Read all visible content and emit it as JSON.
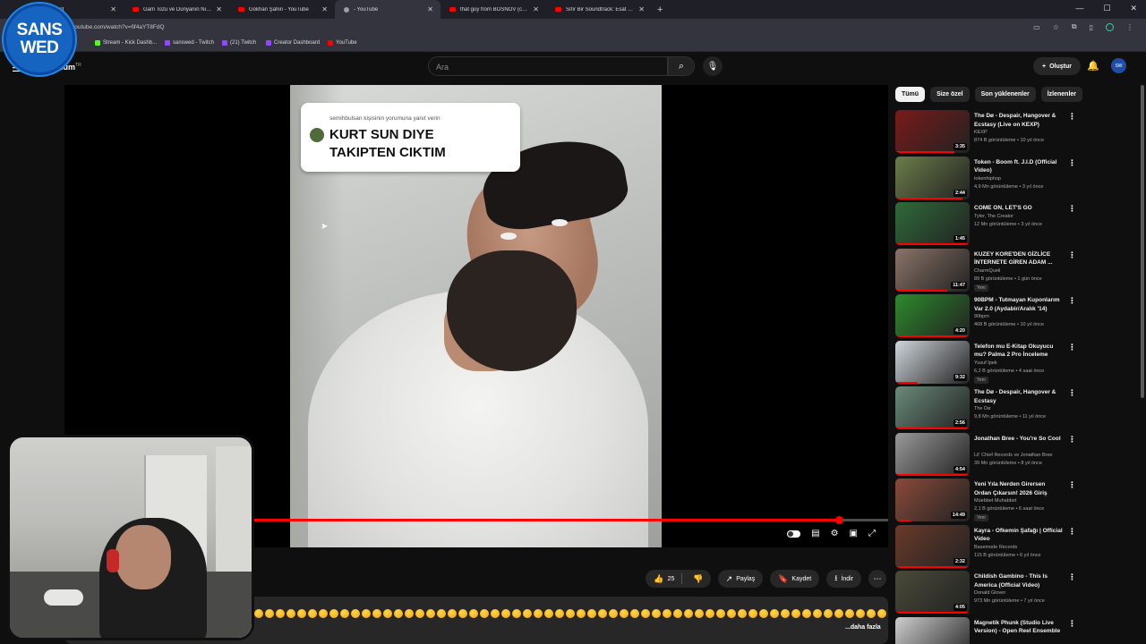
{
  "browser": {
    "tabs": [
      {
        "label": "Dashboard",
        "favicon": "youtube-icon"
      },
      {
        "label": "Gam Tozu ve Dünyanın Ninnisi",
        "favicon": "youtube-icon"
      },
      {
        "label": "Gökhan Şahin - YouTube",
        "favicon": "youtube-icon"
      },
      {
        "label": "- YouTube",
        "favicon": "youtube-icon"
      },
      {
        "label": "that guy from BOSNOV (compilation",
        "favicon": "youtube-icon"
      },
      {
        "label": "Sıfır Bir Soundtrack: Esat Bargun",
        "favicon": "youtube-icon"
      }
    ],
    "new_tab": "+",
    "url": "youtube.com/watch?v=fif4aYT8FdQ",
    "bookmarks": [
      {
        "label": "Stream - Kick Dashb...",
        "icon": "kick-icon"
      },
      {
        "label": "sanswed - Twitch",
        "icon": "twitch-icon"
      },
      {
        "label": "(21) Twitch",
        "icon": "twitch-icon"
      },
      {
        "label": "Creator Dashboard",
        "icon": "twitch-icon"
      },
      {
        "label": "YouTube",
        "icon": "youtube-icon"
      }
    ]
  },
  "overlay_logo": {
    "line1": "SANS",
    "line2": "WED",
    "color": "#1565c0"
  },
  "header": {
    "brand": "mium",
    "brand_suffix": "TR",
    "search_placeholder": "Ara",
    "create_label": "Oluştur"
  },
  "video": {
    "caption_sub": "semihbulsan kişisinin yorumuna yanıt verin",
    "caption_main_1": "KURT SUN DIYE",
    "caption_main_2": "TAKIPTEN CIKTIM",
    "progress": 0.94
  },
  "actions": {
    "likes": "25",
    "share": "Paylaş",
    "save": "Kaydet",
    "download": "İndir"
  },
  "description": {
    "more": "...daha fazla",
    "emoji_count": 61
  },
  "chips": [
    "Tümü",
    "Size özel",
    "Son yüklenenler",
    "İzlenenler"
  ],
  "recommendations": [
    {
      "title": "The Dø - Despair, Hangover & Ecstasy (Live on KEXP)",
      "channel": "KEXP",
      "meta": "874 B görüntüleme • 10 yıl önce",
      "duration": "3:35",
      "badge": "",
      "watched": 0.8,
      "thumb": "#7a1a1a"
    },
    {
      "title": "Token - Boom ft. J.I.D (Official Video)",
      "channel": "tokenhiphop",
      "meta": "4,9 Mn görüntüleme • 3 yıl önce",
      "duration": "2:44",
      "badge": "",
      "watched": 0.9,
      "thumb": "#6b7d4a"
    },
    {
      "title": "COME ON, LET'S GO",
      "channel": "Tyler, The Creator",
      "meta": "12 Mn görüntüleme • 3 yıl önce",
      "duration": "1:45",
      "badge": "",
      "watched": 1.0,
      "thumb": "#2f6a3a"
    },
    {
      "title": "KUZEY KORE'DEN GİZLİCE İNTERNETE GİREN ADAM ...",
      "channel": "CharmQueli",
      "meta": "89 B görüntüleme • 1 gün önce",
      "duration": "11:47",
      "badge": "Yeni",
      "watched": 0.7,
      "thumb": "#8a7468"
    },
    {
      "title": "90BPM - Tutmayan Kuponlarım Var 2.0 (Aydabir/Aralık '14)",
      "channel": "90bpm",
      "meta": "468 B görüntüleme • 10 yıl önce",
      "duration": "4:20",
      "badge": "",
      "watched": 1.0,
      "thumb": "#2d8a2d"
    },
    {
      "title": "Telefon mu E-Kitap Okuyucu mu? Palma 2 Pro İnceleme",
      "channel": "Yusuf İpek",
      "meta": "6,2 B görüntüleme • 4 saat önce",
      "duration": "9:32",
      "badge": "Yeni",
      "watched": 0.3,
      "thumb": "#cfd6dc"
    },
    {
      "title": "The Dø - Despair, Hangover & Ecstasy",
      "channel": "The Dø",
      "meta": "9,8 Mn görüntüleme • 11 yıl önce",
      "duration": "2:56",
      "badge": "",
      "watched": 1.0,
      "thumb": "#6a8a7a"
    },
    {
      "title": "Jonathan Bree - You're So Cool",
      "channel": "Lil' Chief Records ve Jonathan Bree",
      "meta": "39 Mn görüntüleme • 8 yıl önce",
      "duration": "4:54",
      "badge": "",
      "watched": 1.0,
      "thumb": "#9a9a9a"
    },
    {
      "title": "Yeni Yıla Nerden Girersen Ordan Çıkarsın! 2026 Giriş Kapısı ...",
      "channel": "Müebbet Muhabbet",
      "meta": "2,1 B görüntüleme • 6 saat önce",
      "duration": "14:49",
      "badge": "Yeni",
      "watched": 0.2,
      "thumb": "#8a4a3a"
    },
    {
      "title": "Kayra - Ofkemin Şafağı | Official Video",
      "channel": "Basemode Records",
      "meta": "115 B görüntüleme • 6 yıl önce",
      "duration": "2:32",
      "badge": "",
      "watched": 1.0,
      "thumb": "#6a3a2a"
    },
    {
      "title": "Childish Gambino - This Is America (Official Video)",
      "channel": "Donald Glover",
      "meta": "973 Mn görüntüleme • 7 yıl önce",
      "duration": "4:05",
      "badge": "",
      "watched": 1.0,
      "thumb": "#4a4a3a"
    },
    {
      "title": "Magnetik Phunk (Studio Live Version) - Open Reel Ensemble",
      "channel": "",
      "meta": "",
      "duration": "",
      "badge": "",
      "watched": 0,
      "thumb": "#cfcfcf"
    }
  ]
}
